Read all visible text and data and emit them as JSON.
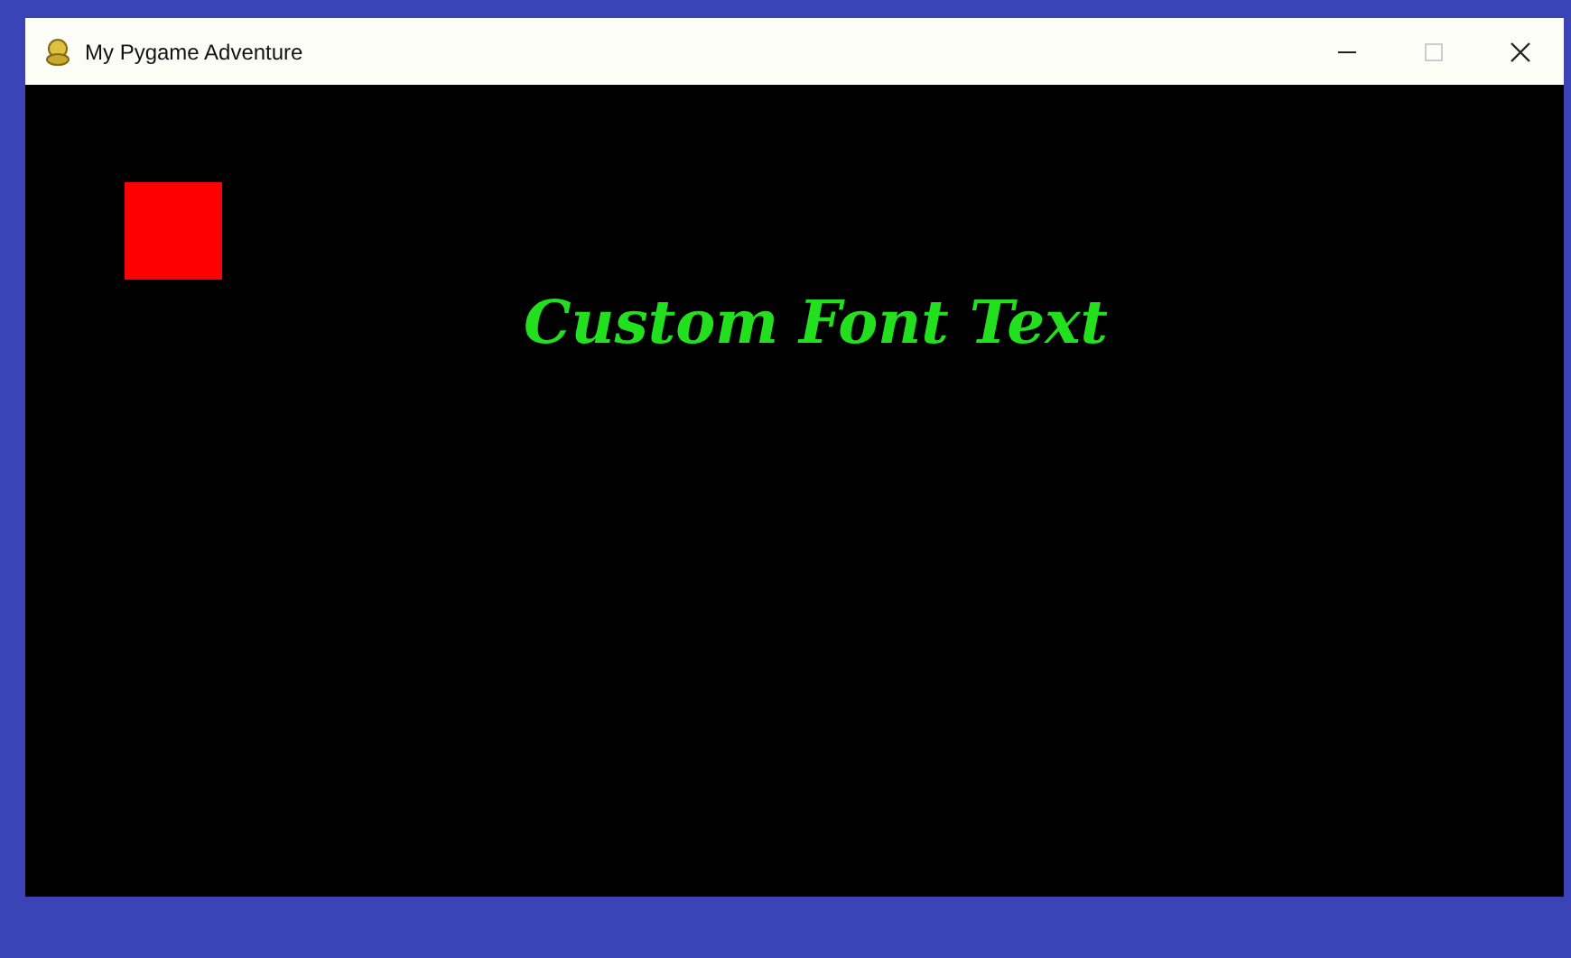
{
  "window": {
    "title": "My Pygame Adventure",
    "maximize_disabled": true
  },
  "canvas": {
    "objects": [
      {
        "kind": "rect",
        "color": "#ff0000"
      },
      {
        "kind": "text",
        "text": "Custom Font Text",
        "color": "#22e01e"
      }
    ]
  }
}
